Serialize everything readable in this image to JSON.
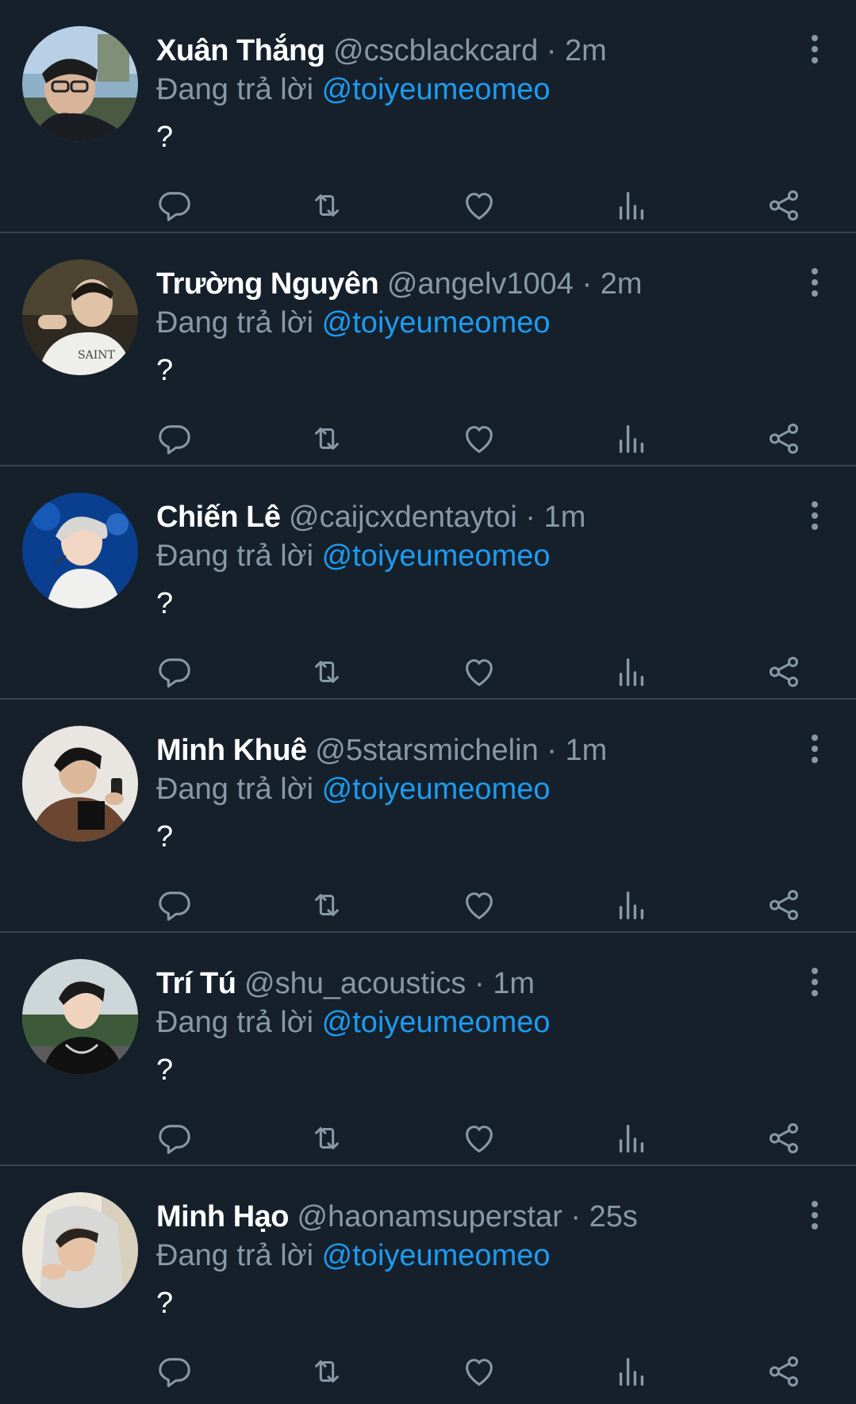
{
  "colors": {
    "background": "#15202b",
    "divider": "#38444d",
    "muted": "#8899a6",
    "mention": "#1d9bf0",
    "text": "#ffffff"
  },
  "icons": {
    "reply": "reply-icon",
    "retweet": "retweet-icon",
    "like": "heart-icon",
    "views": "views-icon",
    "share": "share-icon",
    "more": "more-icon"
  },
  "tweets": [
    {
      "name": "Xuân Thắng",
      "handle": "@cscblackcard",
      "separator": "·",
      "time": "2m",
      "reply_prefix": "Đang trả lời",
      "reply_to": "@toiyeumeomeo",
      "text": "?"
    },
    {
      "name": "Trường Nguyên",
      "handle": "@angelv1004",
      "separator": "·",
      "time": "2m",
      "reply_prefix": "Đang trả lời",
      "reply_to": "@toiyeumeomeo",
      "text": "?"
    },
    {
      "name": "Chiến Lê",
      "handle": "@caijcxdentaytoi",
      "separator": "·",
      "time": "1m",
      "reply_prefix": "Đang trả lời",
      "reply_to": "@toiyeumeomeo",
      "text": "?"
    },
    {
      "name": "Minh Khuê",
      "handle": "@5starsmichelin",
      "separator": "·",
      "time": "1m",
      "reply_prefix": "Đang trả lời",
      "reply_to": "@toiyeumeomeo",
      "text": "?"
    },
    {
      "name": "Trí Tú",
      "handle": "@shu_acoustics",
      "separator": "·",
      "time": "1m",
      "reply_prefix": "Đang trả lời",
      "reply_to": "@toiyeumeomeo",
      "text": "?"
    },
    {
      "name": "Minh Hạo",
      "handle": "@haonamsuperstar",
      "separator": "·",
      "time": "25s",
      "reply_prefix": "Đang trả lời",
      "reply_to": "@toiyeumeomeo",
      "text": "?"
    }
  ]
}
